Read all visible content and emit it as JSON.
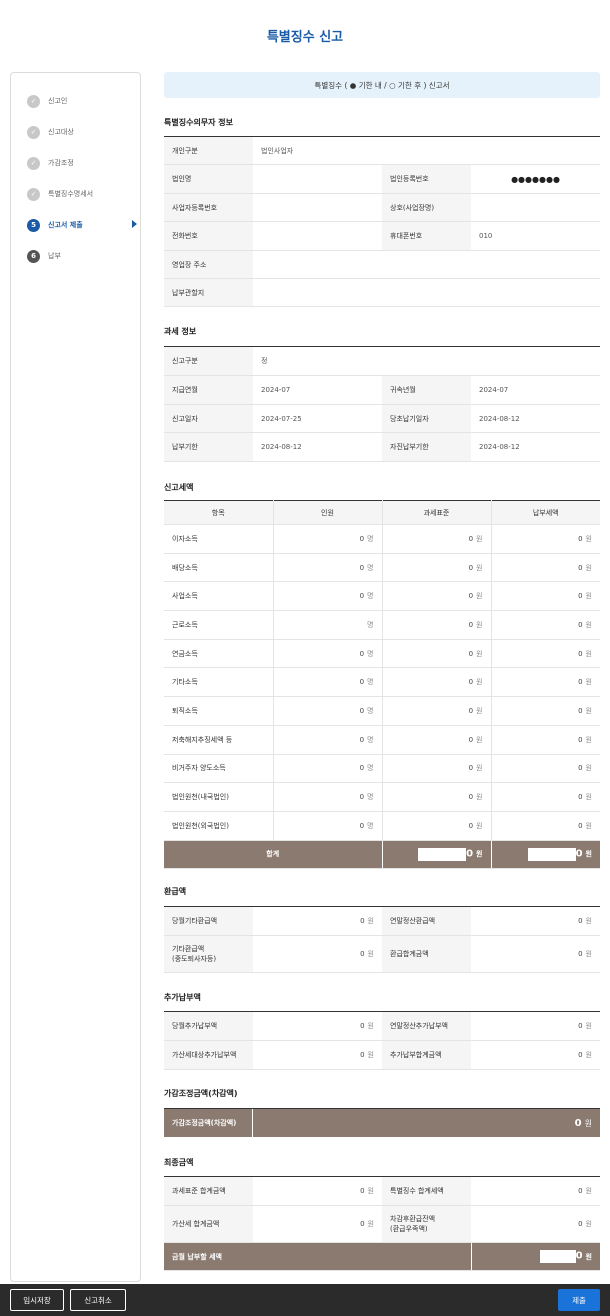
{
  "page_title": "특별징수 신고",
  "steps": [
    {
      "num": "✓",
      "label": "신고인",
      "state": "done"
    },
    {
      "num": "✓",
      "label": "신고대상",
      "state": "done"
    },
    {
      "num": "✓",
      "label": "가감조정",
      "state": "done"
    },
    {
      "num": "✓",
      "label": "특별징수명세서",
      "state": "done"
    },
    {
      "num": "5",
      "label": "신고서 제출",
      "state": "current"
    },
    {
      "num": "6",
      "label": "납부",
      "state": "todo"
    }
  ],
  "banner": "특별징수 ( ● 기한 내 / ○ 기한 후 ) 신고서",
  "obligor": {
    "title": "특별징수의무자 정보",
    "person_type_label": "개인구분",
    "person_type_value": "법인사업자",
    "corp_name_label": "법인명",
    "corp_name_value": "",
    "corp_reg_label": "법인등록번호",
    "corp_reg_value": "●●●●●●●",
    "biz_reg_label": "사업자등록번호",
    "biz_reg_value": "",
    "trade_name_label": "상호(사업장명)",
    "trade_name_value": "",
    "phone_label": "전화번호",
    "phone_value": "",
    "mobile_label": "휴대폰번호",
    "mobile_value": "010",
    "address_label": "영업장 주소",
    "address_value": "",
    "jurisdiction_label": "납부관할지",
    "jurisdiction_value": ""
  },
  "tax_info": {
    "title": "과세 정보",
    "report_type_label": "신고구분",
    "report_type_value": "정",
    "pay_month_label": "지급연월",
    "pay_month_value": "2024-07",
    "attr_month_label": "귀속년월",
    "attr_month_value": "2024-07",
    "report_date_label": "신고일자",
    "report_date_value": "2024-07-25",
    "orig_due_label": "당초납기일자",
    "orig_due_value": "2024-08-12",
    "due_label": "납부기한",
    "due_value": "2024-08-12",
    "self_due_label": "자진납부기한",
    "self_due_value": "2024-08-12"
  },
  "amounts": {
    "title": "신고세액",
    "headers": [
      "항목",
      "인원",
      "과세표준",
      "납부세액"
    ],
    "unit_person": "명",
    "unit_won": "원",
    "rows": [
      {
        "name": "이자소득",
        "people": "0",
        "base": "0",
        "tax": "0"
      },
      {
        "name": "배당소득",
        "people": "0",
        "base": "0",
        "tax": "0"
      },
      {
        "name": "사업소득",
        "people": "0",
        "base": "0",
        "tax": "0"
      },
      {
        "name": "근로소득",
        "people": "",
        "base": "0",
        "tax": "0"
      },
      {
        "name": "연금소득",
        "people": "0",
        "base": "0",
        "tax": "0"
      },
      {
        "name": "기타소득",
        "people": "0",
        "base": "0",
        "tax": "0"
      },
      {
        "name": "퇴직소득",
        "people": "0",
        "base": "0",
        "tax": "0"
      },
      {
        "name": "저축해지추징세액 등",
        "people": "0",
        "base": "0",
        "tax": "0"
      },
      {
        "name": "비거주자 양도소득",
        "people": "0",
        "base": "0",
        "tax": "0"
      },
      {
        "name": "법인원천(내국법인)",
        "people": "0",
        "base": "0",
        "tax": "0"
      },
      {
        "name": "법인원천(외국법인)",
        "people": "0",
        "base": "0",
        "tax": "0"
      }
    ],
    "total_label": "합계",
    "total_base": "0",
    "total_tax": "0"
  },
  "refund": {
    "title": "환급액",
    "month_other_label": "당월기타환급액",
    "month_other_value": "0",
    "yearend_label": "연말정산환급액",
    "yearend_value": "0",
    "other_label_1": "기타환급액",
    "other_label_2": "(중도퇴사자등)",
    "other_value": "0",
    "total_label": "환급합계금액",
    "total_value": "0"
  },
  "additional": {
    "title": "추가납부액",
    "month_add_label": "당월추가납부액",
    "month_add_value": "0",
    "yearend_add_label": "연말정산추가납부액",
    "yearend_add_value": "0",
    "penalty_label": "가산세대상추가납부액",
    "penalty_value": "0",
    "total_label": "추가납부합계금액",
    "total_value": "0"
  },
  "adjust": {
    "title": "가감조정금액(차감액)",
    "label": "가감조정금액(차감액)",
    "value": "0"
  },
  "final": {
    "title": "최종금액",
    "base_total_label": "과세표준 합계금액",
    "base_total_value": "0",
    "special_total_label": "특별징수 합계세액",
    "special_total_value": "0",
    "penalty_total_label": "가산세 합계금액",
    "penalty_total_value": "0",
    "after_label_1": "차감후환급잔액",
    "after_label_2": "(환급우족액)",
    "after_value": "0",
    "pay_label": "금월 납부할 세액",
    "pay_value": "0"
  },
  "footer": {
    "temp_save": "임시저장",
    "cancel": "신고취소",
    "submit": "제출"
  }
}
